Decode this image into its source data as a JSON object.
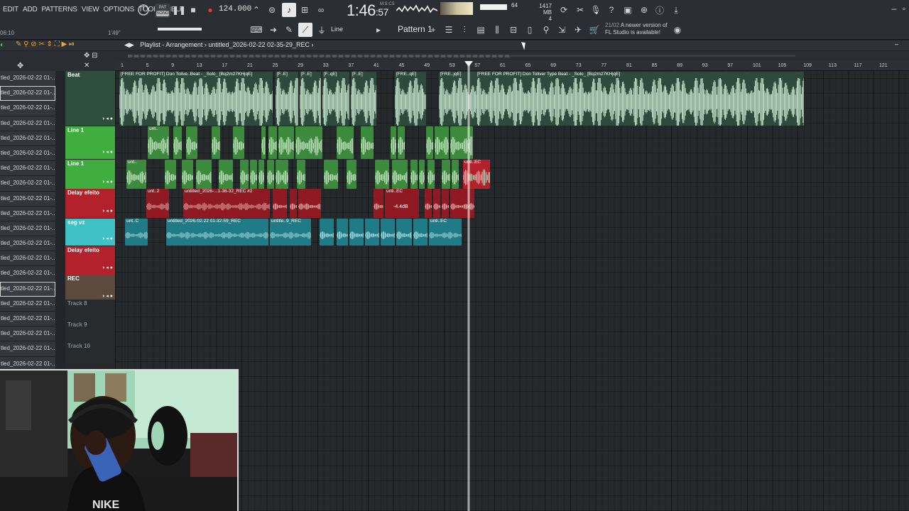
{
  "menu": [
    "EDIT",
    "ADD",
    "PATTERNS",
    "VIEW",
    "OPTIONS",
    "TOOLS",
    "HELP"
  ],
  "song_position": "06:10",
  "song_position_2": "1'49\"",
  "transport": {
    "mode_top": "PAT",
    "mode_bottom": "SONG",
    "tempo": "124.000",
    "time_main": "1:46",
    "time_sec": ":57",
    "time_unit": "M:S:CS"
  },
  "master": {
    "voices": "64",
    "cpu_mem": "1417 MB",
    "cpu_num": "4",
    "cpu_zero": "0"
  },
  "snap_label": "Line",
  "pattern_label": "Pattern 1",
  "news": {
    "date": "21/02",
    "line1": "A newer version of",
    "line2": "FL Studio is available!"
  },
  "playlist": {
    "title": "Playlist - Arrangement",
    "breadcrumb": "untitled_2026-02-22 02-35-29_REC"
  },
  "ruler_ticks": [
    "1",
    "5",
    "9",
    "13",
    "17",
    "21",
    "25",
    "29",
    "33",
    "37",
    "41",
    "45",
    "49",
    "53",
    "57",
    "61",
    "65",
    "69",
    "73",
    "77",
    "81",
    "85",
    "89",
    "93",
    "97",
    "101",
    "105",
    "109",
    "113",
    "117",
    "121"
  ],
  "browser_items": [
    "tled_2026-02-22 01-...",
    "tled_2026-02-22 01-...",
    "tled_2026-02-22 01-...",
    "tled_2026-02-22 01-...",
    "tled_2026-02-22 01-...",
    "tled_2026-02-22 01-...",
    "tled_2026-02-22 01-...",
    "tled_2026-02-22 01-...",
    "tled_2026-02-22 01-...",
    "tled_2026-02-22 01-...",
    "tled_2026-02-22 01-...",
    "tled_2026-02-22 01-...",
    "tled_2026-02-22 01-...",
    "tled_2026-02-22 01-...",
    "tled_2026-02-22 01-...",
    "tled_2026-02-22 01-...",
    "tled_2026-02-22 01-...",
    "tled_2026-02-22 01-...",
    "tled_2026-02-22 01-...",
    "tled_2026-02-22 01-..."
  ],
  "tracks": [
    {
      "name": "Beat",
      "color": "#2f4e3e"
    },
    {
      "name": "Line 1",
      "color": "#3fae3f"
    },
    {
      "name": "Line 1",
      "color": "#3fae3f"
    },
    {
      "name": "Delay efeito",
      "color": "#b3212b"
    },
    {
      "name": "seg vz",
      "color": "#3fc1c6"
    },
    {
      "name": "Delay efeito",
      "color": "#b3212b"
    },
    {
      "name": "REC",
      "color": "#5c4a3c"
    },
    {
      "name": "Track 8",
      "color": "#272b2e"
    },
    {
      "name": "Track 9",
      "color": "#272b2e"
    },
    {
      "name": "Track 10",
      "color": "#272b2e"
    }
  ],
  "clip_labels": {
    "beat_a": "[FREE FOR PROFIT] Don Tolive..Beat - _Solo_ [Bq2m27KHjqE]",
    "beat_b": "[F..E]",
    "beat_c": "[F..E]",
    "beat_d": "[F..qE]",
    "beat_e": "[F..E]",
    "beat_f": "[FRE..qE]",
    "beat_g": "[FRE..jqE]",
    "beat_h": "[FREE FOR PROFIT] Don Toliver Type Beat - _Solo_ [Bq2m27KHjqE]",
    "line1_a": "unt..",
    "line1b_a": "unt..",
    "line1b_red": "unti..EC",
    "delay_a": "unt..2",
    "delay_b": "untitled_2026-...1-36-32_REC #2",
    "delay_c": "unti..EC",
    "delay_gain": "-4.4dB",
    "seg_a": "unt..C",
    "seg_b": "untitled_2026-02-22 01-32-59_REC",
    "seg_c": "untitle..9_REC",
    "seg_d": "unti..EC"
  }
}
